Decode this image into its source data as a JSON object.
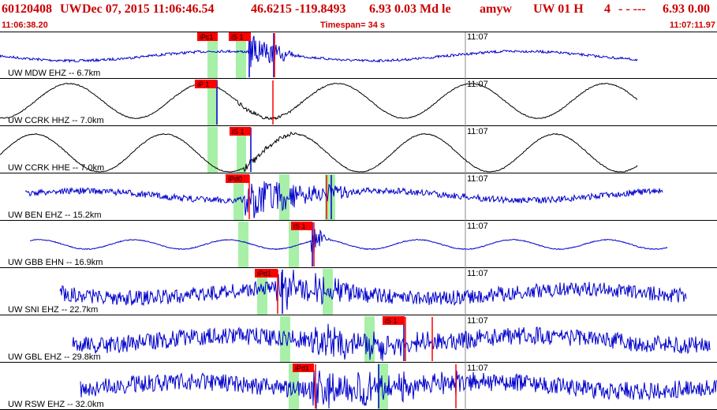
{
  "header": {
    "event_id": "60120408",
    "network": "UW",
    "datetime": "Dec 07, 2015 11:06:46.54",
    "lat_lon": "46.6215 -119.8493",
    "mag_info": "6.93 0.03 Md le",
    "analyst": "amyw",
    "source": "UW 01 H",
    "count": "4",
    "dashes": "- - ---",
    "magnitude": "6.93 0.00",
    "start_time": "11:06:38.20",
    "timespan": "Timespan=  34 s",
    "end_time": "11:07:11.97"
  },
  "colors": {
    "header_red": "#cc0000",
    "trace_blue": "#0000cc",
    "trace_black": "#000000",
    "pick_red": "#ff0000",
    "window_green": "#a8f0a8"
  },
  "traces": [
    {
      "label": "UW MDW EHZ -- 6.7km",
      "time_mark": "11:07",
      "color": "blue",
      "picks": [
        "iPc1",
        "iS 1"
      ]
    },
    {
      "label": "UW CCRK HHZ -- 7.0km",
      "time_mark": "11:07",
      "color": "black",
      "picks": [
        "iP 1"
      ]
    },
    {
      "label": "UW CCRK HHE -- 7.0km",
      "time_mark": "11:07",
      "color": "black",
      "picks": [
        "iS 1"
      ]
    },
    {
      "label": "UW BEN EHZ -- 15.2km",
      "time_mark": "11:07",
      "color": "blue",
      "picks": [
        "iPd0"
      ]
    },
    {
      "label": "UW GBB EHN -- 16.9km",
      "time_mark": "11:07",
      "color": "blue",
      "picks": [
        "iS 1"
      ]
    },
    {
      "label": "UW SNI EHZ -- 22.7km",
      "time_mark": "11:07",
      "color": "blue",
      "picks": [
        "iPd1"
      ]
    },
    {
      "label": "UW GBL EHZ -- 29.8km",
      "time_mark": "11:07",
      "color": "blue",
      "picks": [
        "iS 1"
      ]
    },
    {
      "label": "UW RSW EHZ -- 32.0km",
      "time_mark": "11:07",
      "color": "blue",
      "picks": [
        "iPd1"
      ]
    }
  ]
}
